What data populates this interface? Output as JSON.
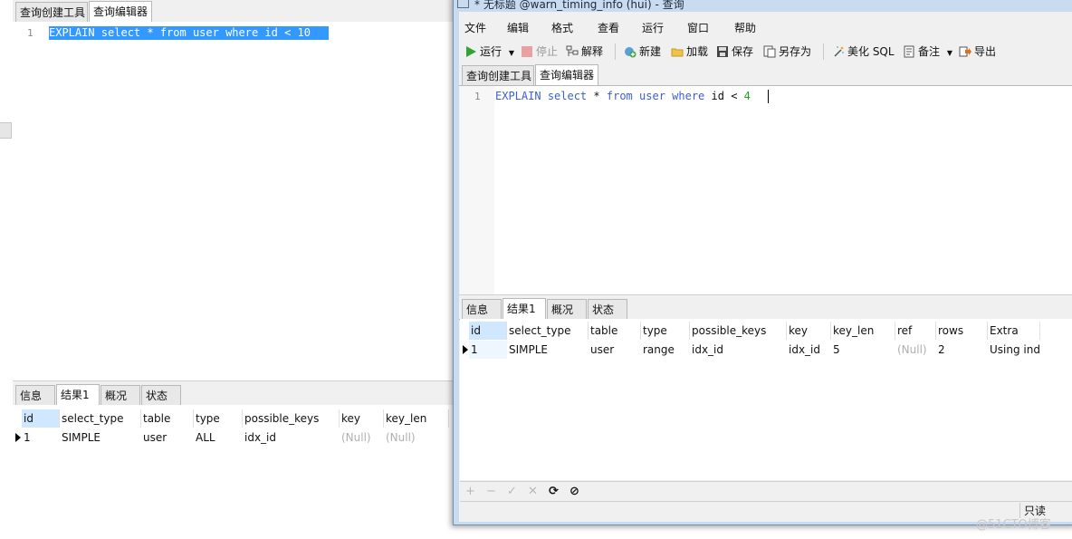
{
  "left_window": {
    "top_tabs": [
      "查询创建工具",
      "查询编辑器"
    ],
    "editor": {
      "line_number": "1",
      "sql": "EXPLAIN select * from user where id < 10"
    },
    "result_tabs": [
      "信息",
      "结果1",
      "概况",
      "状态"
    ],
    "grid": {
      "columns": [
        "id",
        "select_type",
        "table",
        "type",
        "possible_keys",
        "key",
        "key_len"
      ],
      "rows": [
        [
          "1",
          "SIMPLE",
          "user",
          "ALL",
          "idx_id",
          "(Null)",
          "(Null)"
        ]
      ]
    }
  },
  "right_window": {
    "title": "* 无标题 @warn_timing_info (hui) - 查询",
    "menu": [
      "文件",
      "编辑",
      "格式",
      "查看",
      "运行",
      "窗口",
      "帮助"
    ],
    "toolbar": {
      "run": "运行",
      "stop": "停止",
      "explain": "解释",
      "new": "新建",
      "load": "加载",
      "save": "保存",
      "save_as": "另存为",
      "beautify": "美化 SQL",
      "notes": "备注",
      "export": "导出"
    },
    "top_tabs": [
      "查询创建工具",
      "查询编辑器"
    ],
    "editor": {
      "line_number": "1",
      "sql_tokens": [
        "EXPLAIN",
        "select",
        "*",
        "from",
        "user",
        "where",
        "id",
        "<",
        "4"
      ]
    },
    "result_tabs": [
      "信息",
      "结果1",
      "概况",
      "状态"
    ],
    "grid": {
      "columns": [
        "id",
        "select_type",
        "table",
        "type",
        "possible_keys",
        "key",
        "key_len",
        "ref",
        "rows",
        "Extra"
      ],
      "rows": [
        [
          "1",
          "SIMPLE",
          "user",
          "range",
          "idx_id",
          "idx_id",
          "5",
          "(Null)",
          "2",
          "Using inde"
        ]
      ]
    },
    "bottom_buttons": [
      "+",
      "−",
      "✓",
      "✕",
      "⟳",
      "⊘"
    ],
    "status_text": "只读"
  },
  "watermark": "@51CTO博客",
  "colors": {
    "selection": "#3399ff",
    "keyword": "#3b5fd6",
    "number": "#22a022",
    "null_text": "#b0b0b0"
  }
}
